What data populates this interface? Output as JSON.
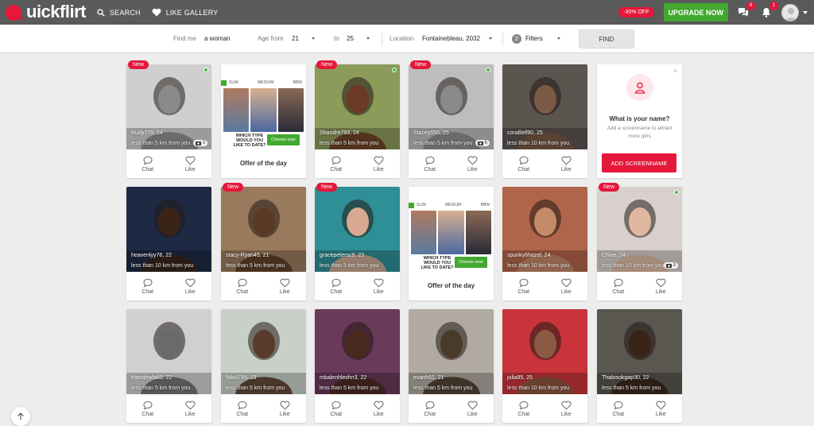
{
  "brand": {
    "name": "uickflirt",
    "accent": "#e5173a",
    "green": "#43a82f"
  },
  "nav": {
    "search": "SEARCH",
    "like_gallery": "LIKE GALLERY"
  },
  "topbar": {
    "discount": "-30% OFF",
    "upgrade": "UPGRADE NOW",
    "messages_count": "8",
    "notifications_count": "1"
  },
  "filter": {
    "find_me_label": "Find me",
    "find_me_value": "a woman",
    "age_from_label": "Age from",
    "age_from_value": "21",
    "age_to_label": "to",
    "age_to_value": "25",
    "location_label": "Location",
    "location_value": "Fontainebleau, 2032",
    "filters_count": "2",
    "filters_label": "Filters",
    "find_button": "FIND"
  },
  "card_labels": {
    "chat": "Chat",
    "like": "Like",
    "new": "New"
  },
  "offer": {
    "tag_slim": "SLIM",
    "tag_medium": "MEDIUM",
    "tag_bbw": "BBW",
    "question": "WHICH TYPE WOULD YOU LIKE TO DATE?",
    "choose": "Choose now",
    "title": "Offer of the day"
  },
  "screenname": {
    "title": "What is your name?",
    "subtitle": "Add a screenname to attract more girls",
    "button": "ADD SCREENNAME"
  },
  "profiles": [
    {
      "name": "Rudy775, 24",
      "distance": "less than 5 km from you",
      "photos": "3",
      "new": true,
      "online": true,
      "tone": "#8a8a8a",
      "bg": "#cfcfcf"
    },
    {
      "name": "Shandre793, 24",
      "distance": "less than 5 km from you",
      "photos": "",
      "new": true,
      "online": true,
      "tone": "#6b3a24",
      "bg": "#8c9a5a"
    },
    {
      "name": "Stacey555, 25",
      "distance": "less than 5 km from you",
      "photos": "6",
      "new": true,
      "online": true,
      "tone": "#8a8a8a",
      "bg": "#bdbdbd"
    },
    {
      "name": "coraBell90, 25",
      "distance": "less than 10 km from you",
      "photos": "",
      "new": false,
      "online": false,
      "tone": "#7a5a44",
      "bg": "#5b5550"
    },
    {
      "name": "heavenlyy76, 22",
      "distance": "less than 10 km from you",
      "photos": "",
      "new": false,
      "online": false,
      "tone": "#3a2418",
      "bg": "#1e2a44"
    },
    {
      "name": "stacy-Ryan45, 21",
      "distance": "less than 5 km from you",
      "photos": "",
      "new": true,
      "online": false,
      "tone": "#5a3a24",
      "bg": "#9a7a5c"
    },
    {
      "name": "gracepetersc9, 23",
      "distance": "less than 5 km from you",
      "photos": "",
      "new": true,
      "online": false,
      "tone": "#d8a890",
      "bg": "#2f8f96"
    },
    {
      "name": "spunky6hazel, 24",
      "distance": "less than 10 km from you",
      "photos": "",
      "new": false,
      "online": false,
      "tone": "#c48a6a",
      "bg": "#b0644a"
    },
    {
      "name": "Chloe, 24",
      "distance": "less than 10 km from you",
      "photos": "3",
      "new": true,
      "online": true,
      "tone": "#e0b8a0",
      "bg": "#d8d0cc"
    },
    {
      "name": "thandowla83, 22",
      "distance": "less than 5 km from you",
      "photos": "",
      "new": false,
      "online": false,
      "tone": "#6a6a6a",
      "bg": "#d0d0d0"
    },
    {
      "name": "Nikki799, 23",
      "distance": "less than 5 km from you",
      "photos": "",
      "new": false,
      "online": false,
      "tone": "#5a3a2a",
      "bg": "#c8d0c8"
    },
    {
      "name": "mbalenhleshn3, 22",
      "distance": "less than 5 km from you",
      "photos": "",
      "new": false,
      "online": false,
      "tone": "#4a2a1e",
      "bg": "#6a3a5a"
    },
    {
      "name": "evanh51, 21",
      "distance": "less than 5 km from you",
      "photos": "",
      "new": false,
      "online": false,
      "tone": "#4a3a2a",
      "bg": "#b0aaa0"
    },
    {
      "name": "julia85, 25",
      "distance": "less than 10 km from you",
      "photos": "",
      "new": false,
      "online": false,
      "tone": "#8a5a44",
      "bg": "#c8343a"
    },
    {
      "name": "Thabisokgap30, 22",
      "distance": "less than 5 km from you",
      "photos": "",
      "new": false,
      "online": false,
      "tone": "#3a2418",
      "bg": "#5a5650"
    }
  ]
}
